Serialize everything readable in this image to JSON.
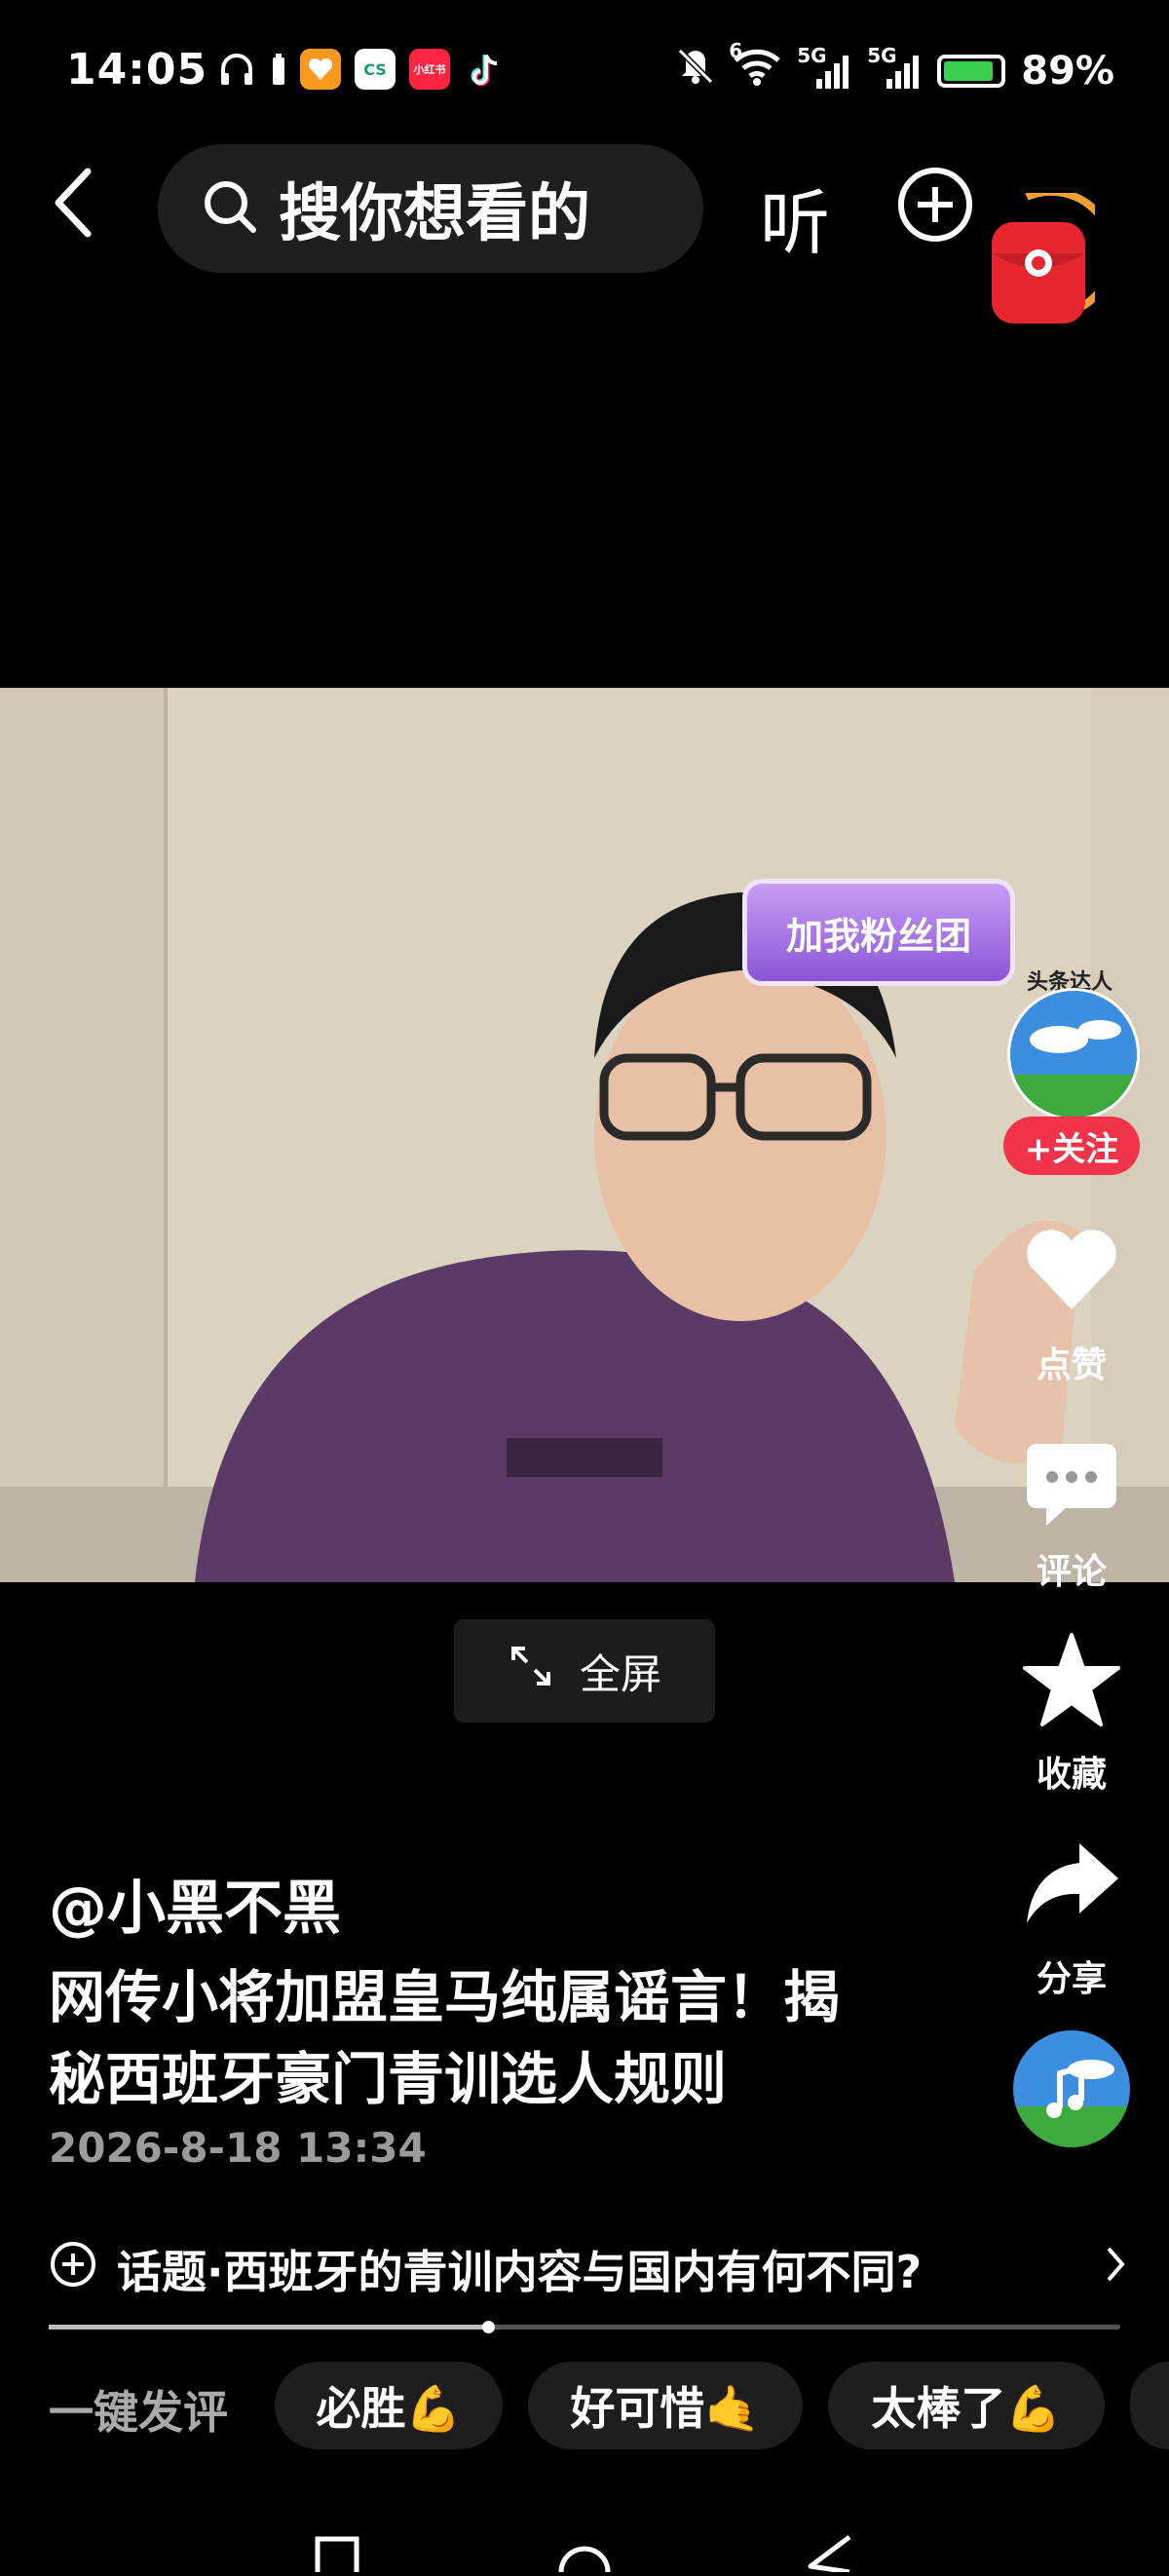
{
  "status_bar": {
    "time": "14:05",
    "app_icons": [
      "headphones-icon",
      "battery-saver-icon",
      "heart-app-icon",
      "cs-app-icon",
      "xiaohongshu-icon",
      "tiktok-icon"
    ],
    "xiaohongshu_label": "小红书",
    "cs_label": "CS",
    "signal_6": "6",
    "signal_5g_1": "5G",
    "signal_5g_2": "5G",
    "battery": "89%",
    "battery_level": 0.89
  },
  "top_nav": {
    "search_placeholder": "搜你想看的",
    "listen_label": "听"
  },
  "video": {
    "fan_badge": "加我粉丝团"
  },
  "fullscreen_label": "全屏",
  "right_rail": {
    "avatar_badge": "头条达人",
    "follow_label": "+关注",
    "like_label": "点赞",
    "comment_label": "评论",
    "favorite_label": "收藏",
    "share_label": "分享"
  },
  "post": {
    "author": "@小黑不黑",
    "title_line1": "网传小将加盟皇马纯属谣言！揭",
    "title_line2": "秘西班牙豪门青训选人规则",
    "date": "2026-8-18 13:34"
  },
  "topic": {
    "text": "话题·西班牙的青训内容与国内有何不同?"
  },
  "progress_fraction": 0.41,
  "quick_comment": {
    "label": "一键发评",
    "chips": [
      "必胜💪",
      "好可惜🤙",
      "太棒了💪"
    ]
  },
  "colors": {
    "background": "#000000",
    "follow_red": "#f2334c",
    "badge_purple": "#8a55d6"
  }
}
